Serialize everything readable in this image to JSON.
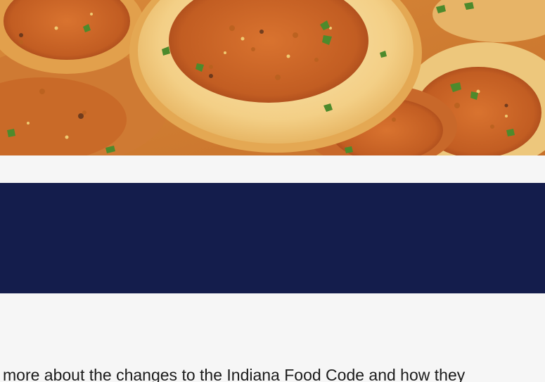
{
  "colors": {
    "page_background": "#f6f6f6",
    "ad_banner": "#141d4c",
    "body_text": "#1b1b1b"
  },
  "article": {
    "text": "more about the changes to the Indiana Food Code and how they"
  }
}
